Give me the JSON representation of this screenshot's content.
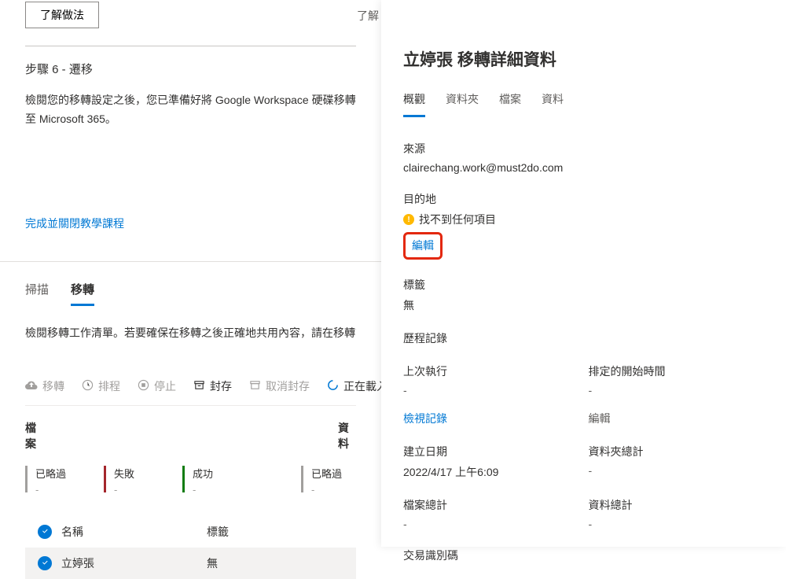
{
  "tutorial": {
    "learn_btn": "了解做法",
    "learn_btn2": "了解",
    "step_title": "步驟 6 - 遷移",
    "step_desc": "檢閱您的移轉設定之後，您已準備好將 Google Workspace 硬碟移轉至 Microsoft 365。",
    "finish_link": "完成並關閉教學課程"
  },
  "main": {
    "tabs": {
      "scan": "掃描",
      "migrate": "移轉"
    },
    "desc": "檢閱移轉工作清單。若要確保在移轉之後正確地共用內容，請在移轉前先設定身分",
    "toolbar": {
      "migrate": "移轉",
      "schedule": "排程",
      "stop": "停止",
      "archive": "封存",
      "unarchive": "取消封存",
      "loading": "正在載入工作"
    },
    "headers": {
      "files": "檔案",
      "data": "資料"
    },
    "stats": {
      "skipped": {
        "label": "已略過",
        "value": "-"
      },
      "failed": {
        "label": "失敗",
        "value": "-"
      },
      "success": {
        "label": "成功",
        "value": "-"
      },
      "skipped2": {
        "label": "已略過",
        "value": "-"
      }
    },
    "table": {
      "col_name": "名稱",
      "col_tag": "標籤",
      "row1_name": "立婷張",
      "row1_tag": "無"
    }
  },
  "panel": {
    "title": "立婷張 移轉詳細資料",
    "tabs": {
      "overview": "概觀",
      "folders": "資料夾",
      "files": "檔案",
      "data": "資料"
    },
    "source_label": "來源",
    "source_value": "clairechang.work@must2do.com",
    "dest_label": "目的地",
    "dest_value": "找不到任何項目",
    "edit": "編輯",
    "tag_label": "標籤",
    "tag_value": "無",
    "history_label": "歷程記錄",
    "lastrun_label": "上次執行",
    "lastrun_value": "-",
    "sched_label": "排定的開始時間",
    "sched_value": "-",
    "viewlog": "檢視記錄",
    "edit2": "編輯",
    "created_label": "建立日期",
    "created_value": "2022/4/17 上午6:09",
    "folders_total_label": "資料夾總計",
    "folders_total_value": "-",
    "files_total_label": "檔案總計",
    "files_total_value": "-",
    "data_total_label": "資料總計",
    "data_total_value": "-",
    "txid_label": "交易識別碼"
  }
}
